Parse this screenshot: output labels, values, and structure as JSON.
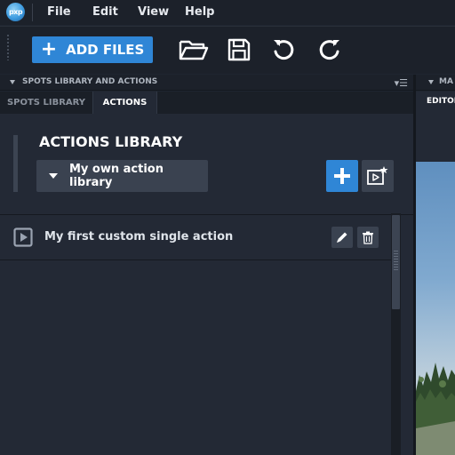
{
  "app": {
    "logo_text": "pxp"
  },
  "menu": [
    "File",
    "Edit",
    "View",
    "Help"
  ],
  "toolbar": {
    "add_files_label": "ADD FILES",
    "icons": [
      "open-folder-icon",
      "save-icon",
      "undo-icon",
      "redo-icon"
    ]
  },
  "panel": {
    "title": "SPOTS LIBRARY AND ACTIONS",
    "tabs": [
      {
        "label": "SPOTS LIBRARY",
        "active": false
      },
      {
        "label": "ACTIONS",
        "active": true
      }
    ],
    "library_title": "ACTIONS LIBRARY",
    "library_select": "My own action library",
    "actions": [
      {
        "label": "My first custom single action"
      }
    ]
  },
  "right_panel": {
    "title": "MA",
    "tab": "EDITOR"
  },
  "colors": {
    "accent": "#2f86d6",
    "panel_bg": "#232935",
    "chrome_bg": "#1c212a"
  }
}
